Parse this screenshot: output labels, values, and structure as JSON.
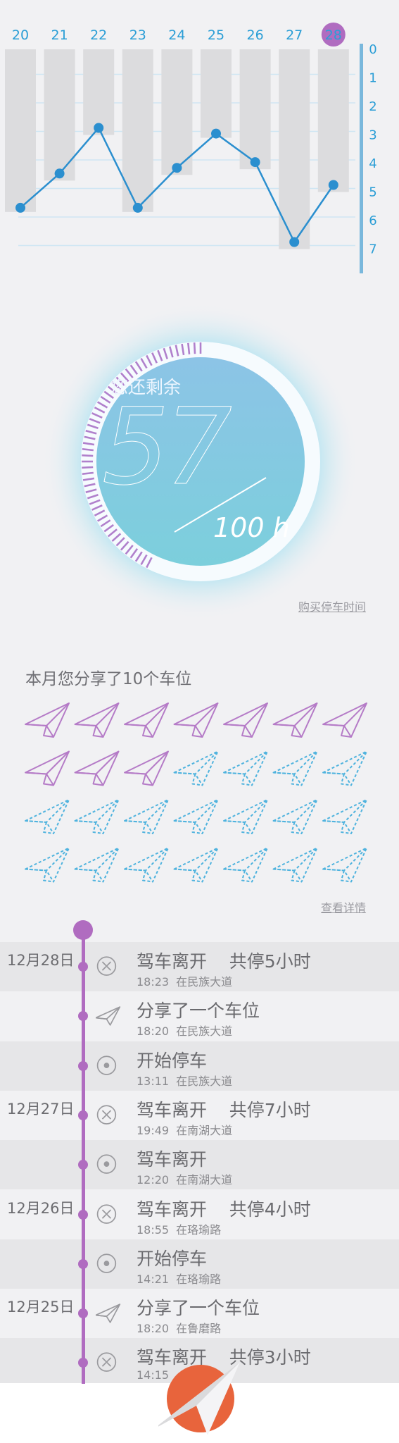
{
  "chart": {
    "days": [
      "20",
      "21",
      "22",
      "23",
      "24",
      "25",
      "26",
      "27",
      "28"
    ],
    "day_colors": [
      "#2b9ed6",
      "#2b9ed6",
      "#39a838",
      "#39a838",
      "#2b9ed6",
      "#2b9ed6",
      "#2b9ed6",
      "#2b9ed6",
      "#ffffff"
    ],
    "selected_day": "28",
    "y_ticks": [
      "0",
      "1",
      "2",
      "3",
      "4",
      "5",
      "6",
      "7"
    ],
    "bar_values": [
      5.7,
      4.6,
      3.0,
      5.7,
      4.4,
      3.1,
      4.2,
      7.0,
      5.0
    ],
    "line_values": [
      5.8,
      4.6,
      3.0,
      5.8,
      4.4,
      3.2,
      4.2,
      7.0,
      5.0
    ],
    "accent": "#2b8fcf",
    "bar_color": "#dcdcde"
  },
  "ring": {
    "label": "您还剩余",
    "value": "57",
    "total": "100 h",
    "remaining_fraction": 0.57,
    "purple": "#b080cc",
    "blue_fill": "#7fcbe0"
  },
  "buy_link": "购买停车时间",
  "share": {
    "title": "本月您分享了10个车位",
    "shared_count": 10,
    "total_slots": 28,
    "solid_color": "#b57bc7",
    "dashed_color": "#4fb3de"
  },
  "detail_link": "查看详情",
  "timeline": [
    {
      "date": "12月28日",
      "icon": "close-icon",
      "title": "驾车离开    共停5小时",
      "time": "18:23",
      "place": "在民族大道",
      "dark": true
    },
    {
      "date": "",
      "icon": "paper-plane-icon",
      "title": "分享了一个车位",
      "time": "18:20",
      "place": "在民族大道",
      "dark": false
    },
    {
      "date": "",
      "icon": "target-icon",
      "title": "开始停车",
      "time": "13:11",
      "place": "在民族大道",
      "dark": true
    },
    {
      "date": "12月27日",
      "icon": "close-icon",
      "title": "驾车离开    共停7小时",
      "time": "19:49",
      "place": "在南湖大道",
      "dark": false
    },
    {
      "date": "",
      "icon": "target-icon",
      "title": "驾车离开",
      "time": "12:20",
      "place": "在南湖大道",
      "dark": true
    },
    {
      "date": "12月26日",
      "icon": "close-icon",
      "title": "驾车离开    共停4小时",
      "time": "18:55",
      "place": "在珞瑜路",
      "dark": false
    },
    {
      "date": "",
      "icon": "target-icon",
      "title": "开始停车",
      "time": "14:21",
      "place": "在珞瑜路",
      "dark": true
    },
    {
      "date": "12月25日",
      "icon": "paper-plane-icon",
      "title": "分享了一个车位",
      "time": "18:20",
      "place": "在鲁磨路",
      "dark": false
    },
    {
      "date": "",
      "icon": "close-icon",
      "title": "驾车离开    共停3小时",
      "time": "14:15",
      "place": "",
      "dark": true
    }
  ]
}
